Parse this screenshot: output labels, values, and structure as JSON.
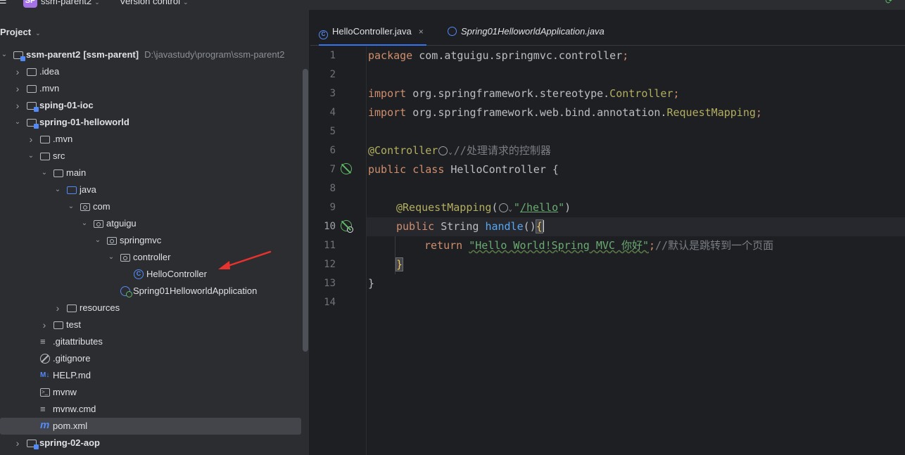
{
  "topbar": {
    "project_badge": "SP",
    "project_name": "ssm-parent2",
    "version_control": "Version control"
  },
  "project_panel": {
    "title": "Project",
    "tree": [
      {
        "label": "ssm-parent2",
        "suffix": "[ssm-parent]",
        "hint": "D:\\javastudy\\program\\ssm-parent2",
        "depth": 0,
        "expanded": true,
        "icon": "module-icon",
        "bold": true
      },
      {
        "label": ".idea",
        "depth": 1,
        "expanded": false,
        "icon": "folder-icon"
      },
      {
        "label": ".mvn",
        "depth": 1,
        "expanded": false,
        "icon": "folder-icon"
      },
      {
        "label": "sping-01-ioc",
        "depth": 1,
        "expanded": false,
        "icon": "module-icon",
        "bold": true
      },
      {
        "label": "spring-01-helloworld",
        "depth": 1,
        "expanded": true,
        "icon": "module-icon",
        "bold": true
      },
      {
        "label": ".mvn",
        "depth": 2,
        "expanded": false,
        "icon": "folder-icon"
      },
      {
        "label": "src",
        "depth": 2,
        "expanded": true,
        "icon": "folder-icon"
      },
      {
        "label": "main",
        "depth": 3,
        "expanded": true,
        "icon": "folder-icon"
      },
      {
        "label": "java",
        "depth": 4,
        "expanded": true,
        "icon": "source-folder-icon"
      },
      {
        "label": "com",
        "depth": 5,
        "expanded": true,
        "icon": "package-icon"
      },
      {
        "label": "atguigu",
        "depth": 6,
        "expanded": true,
        "icon": "package-icon"
      },
      {
        "label": "springmvc",
        "depth": 7,
        "expanded": true,
        "icon": "package-icon"
      },
      {
        "label": "controller",
        "depth": 8,
        "expanded": true,
        "icon": "package-icon"
      },
      {
        "label": "HelloController",
        "depth": 9,
        "icon": "class-icon"
      },
      {
        "label": "Spring01HelloworldApplication",
        "depth": 8,
        "icon": "spring-app-icon"
      },
      {
        "label": "resources",
        "depth": 4,
        "expanded": false,
        "icon": "resources-folder-icon"
      },
      {
        "label": "test",
        "depth": 3,
        "expanded": false,
        "icon": "folder-icon"
      },
      {
        "label": ".gitattributes",
        "depth": 2,
        "icon": "text-file-icon"
      },
      {
        "label": ".gitignore",
        "depth": 2,
        "icon": "ignore-file-icon"
      },
      {
        "label": "HELP.md",
        "depth": 2,
        "icon": "markdown-icon"
      },
      {
        "label": "mvnw",
        "depth": 2,
        "icon": "terminal-file-icon"
      },
      {
        "label": "mvnw.cmd",
        "depth": 2,
        "icon": "text-file-icon"
      },
      {
        "label": "pom.xml",
        "depth": 2,
        "icon": "maven-icon",
        "selected": true
      },
      {
        "label": "spring-02-aop",
        "depth": 1,
        "expanded": false,
        "icon": "module-icon",
        "bold": true
      }
    ]
  },
  "editor": {
    "tabs": [
      {
        "label": "HelloController.java",
        "active": true,
        "close": "×"
      },
      {
        "label": "Spring01HelloworldApplication.java",
        "active": false,
        "italic": true
      }
    ],
    "line_numbers": [
      "1",
      "2",
      "3",
      "4",
      "5",
      "6",
      "7",
      "8",
      "9",
      "10",
      "11",
      "12",
      "13",
      "14"
    ],
    "current_line": 10,
    "code": {
      "l1_kw": "package",
      "l1_rest": " com.atguigu.springmvc.controller",
      "l1_semi": ";",
      "l3_kw": "import",
      "l3_pkg": " org.springframework.stereotype.",
      "l3_cls": "Controller",
      "l3_semi": ";",
      "l4_kw": "import",
      "l4_pkg": " org.springframework.web.bind.annotation.",
      "l4_cls": "RequestMapping",
      "l4_semi": ";",
      "l6_ann": "@Controller",
      "l6_cmt": "//处理请求的控制器",
      "l7_kw": "public class",
      "l7_rest": " HelloController {",
      "l9_ann": "@RequestMapping",
      "l9_open": "(",
      "l9_q1": "\"",
      "l9_path": "/hello",
      "l9_q2": "\"",
      "l9_close": ")",
      "l10_kw": "public",
      "l10_type": " String ",
      "l10_fn": "handle",
      "l10_parens": "()",
      "l10_brace": "{",
      "l11_kw": "return",
      "l11_str": "\"Hello World!Spring MVC 你好\"",
      "l11_semi": ";",
      "l11_cmt": "//默认是跳转到一个页面",
      "l12_brace": "}",
      "l13_brace": "}"
    }
  },
  "colors": {
    "keyword": "#cf8e6d",
    "annotation": "#b3ae60",
    "string": "#6aab73",
    "comment": "#7a7e85",
    "method": "#56a8f5",
    "accent": "#3574f0",
    "arrow": "#e8322d"
  }
}
